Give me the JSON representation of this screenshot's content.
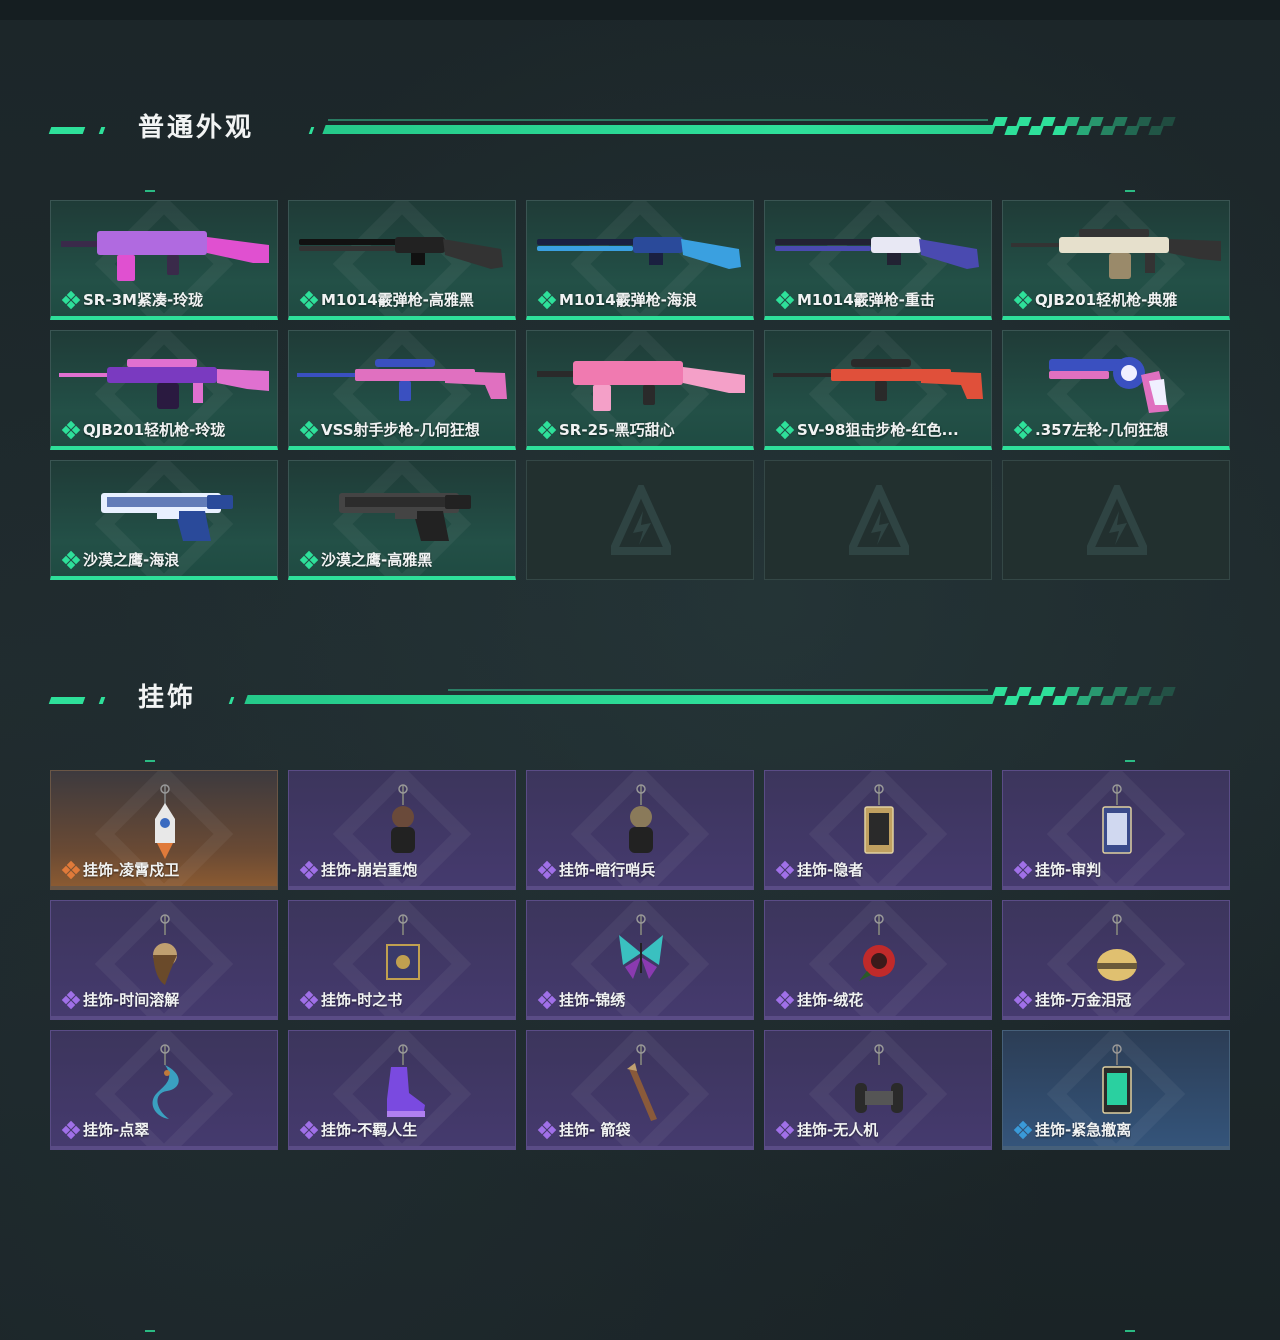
{
  "sections": {
    "skins": {
      "title": "普通外观"
    },
    "charms": {
      "title": "挂饰"
    }
  },
  "weapons": [
    {
      "label": "SR-3M紧凑-玲珑",
      "icon": "rifle-icon",
      "colors": [
        "#b06ae0",
        "#e050d0",
        "#3a2a4a"
      ]
    },
    {
      "label": "M1014霰弹枪-高雅黑",
      "icon": "shotgun-icon",
      "colors": [
        "#222222",
        "#333333",
        "#111111"
      ]
    },
    {
      "label": "M1014霰弹枪-海浪",
      "icon": "shotgun-icon",
      "colors": [
        "#2a4a9a",
        "#3aa0e0",
        "#1a2040"
      ]
    },
    {
      "label": "M1014霰弹枪-重击",
      "icon": "shotgun-icon",
      "colors": [
        "#e8e8f4",
        "#4a4ab0",
        "#222233"
      ]
    },
    {
      "label": "QJB201轻机枪-典雅",
      "icon": "lmg-icon",
      "colors": [
        "#e6e0cc",
        "#333333",
        "#9a8a6a"
      ]
    },
    {
      "label": "QJB201轻机枪-玲珑",
      "icon": "lmg-icon",
      "colors": [
        "#7a3ac0",
        "#e070d0",
        "#2a1a40"
      ]
    },
    {
      "label": "VSS射手步枪-几何狂想",
      "icon": "sniper-icon",
      "colors": [
        "#e070c0",
        "#3a50c0",
        "#f0f0ff"
      ]
    },
    {
      "label": "SR-25-黑巧甜心",
      "icon": "rifle-icon",
      "colors": [
        "#f07ab0",
        "#f4a0c8",
        "#2a2a2a"
      ]
    },
    {
      "label": "SV-98狙击步枪-红色...",
      "icon": "sniper-icon",
      "colors": [
        "#e0503a",
        "#2a2a2a",
        "#c0402a"
      ]
    },
    {
      "label": ".357左轮-几何狂想",
      "icon": "revolver-icon",
      "colors": [
        "#e070c0",
        "#3a50c0",
        "#f0f0ff"
      ]
    },
    {
      "label": "沙漠之鹰-海浪",
      "icon": "pistol-icon",
      "colors": [
        "#2a4a9a",
        "#e8f0ff",
        "#3aa0e0"
      ]
    },
    {
      "label": "沙漠之鹰-高雅黑",
      "icon": "pistol-icon",
      "colors": [
        "#222222",
        "#444444",
        "#111111"
      ]
    }
  ],
  "charms": [
    {
      "label": "挂饰-凌霄戍卫",
      "rarity": "orange",
      "icon": "rocket-charm-icon",
      "colors": [
        "#e8e8e8",
        "#e07a3a"
      ]
    },
    {
      "label": "挂饰-崩岩重炮",
      "rarity": "purple",
      "icon": "figure-charm-icon",
      "colors": [
        "#6a4a3a",
        "#222222"
      ]
    },
    {
      "label": "挂饰-暗行哨兵",
      "rarity": "purple",
      "icon": "figure-charm-icon",
      "colors": [
        "#8a7a5a",
        "#222222"
      ]
    },
    {
      "label": "挂饰-隐者",
      "rarity": "purple",
      "icon": "tarot-card-charm-icon",
      "colors": [
        "#2a2a2a",
        "#c0a060"
      ]
    },
    {
      "label": "挂饰-审判",
      "rarity": "purple",
      "icon": "tarot-card-charm-icon",
      "colors": [
        "#d0d8f0",
        "#3a4a8a"
      ]
    },
    {
      "label": "挂饰-时间溶解",
      "rarity": "purple",
      "icon": "melting-clock-charm-icon",
      "colors": [
        "#c0a070",
        "#6a4a2a"
      ]
    },
    {
      "label": "挂饰-时之书",
      "rarity": "purple",
      "icon": "book-charm-icon",
      "colors": [
        "#c0a050",
        "#3a3a6a"
      ]
    },
    {
      "label": "挂饰-锦绣",
      "rarity": "purple",
      "icon": "butterfly-charm-icon",
      "colors": [
        "#3ac0c0",
        "#8a3ab0"
      ]
    },
    {
      "label": "挂饰-绒花",
      "rarity": "purple",
      "icon": "rose-charm-icon",
      "colors": [
        "#c02a2a",
        "#3a1a1a"
      ]
    },
    {
      "label": "挂饰-万金泪冠",
      "rarity": "purple",
      "icon": "crown-charm-icon",
      "colors": [
        "#e0c070",
        "#6a5a3a"
      ]
    },
    {
      "label": "挂饰-点翠",
      "rarity": "purple",
      "icon": "phoenix-charm-icon",
      "colors": [
        "#3aa0c0",
        "#c07a3a"
      ]
    },
    {
      "label": "挂饰-不羁人生",
      "rarity": "purple",
      "icon": "sneaker-charm-icon",
      "colors": [
        "#7a4ae0",
        "#b080f0"
      ]
    },
    {
      "label": "挂饰- 箭袋",
      "rarity": "purple",
      "icon": "quiver-charm-icon",
      "colors": [
        "#8a5a3a",
        "#c0a070"
      ]
    },
    {
      "label": "挂饰-无人机",
      "rarity": "purple",
      "icon": "drone-charm-icon",
      "colors": [
        "#2a2a2a",
        "#555555"
      ]
    },
    {
      "label": "挂饰-紧急撤离",
      "rarity": "blue",
      "icon": "evac-tag-charm-icon",
      "colors": [
        "#2ad0a0",
        "#2a2a2a"
      ]
    }
  ],
  "empty_slots": 3,
  "accent": "#2ee09a"
}
